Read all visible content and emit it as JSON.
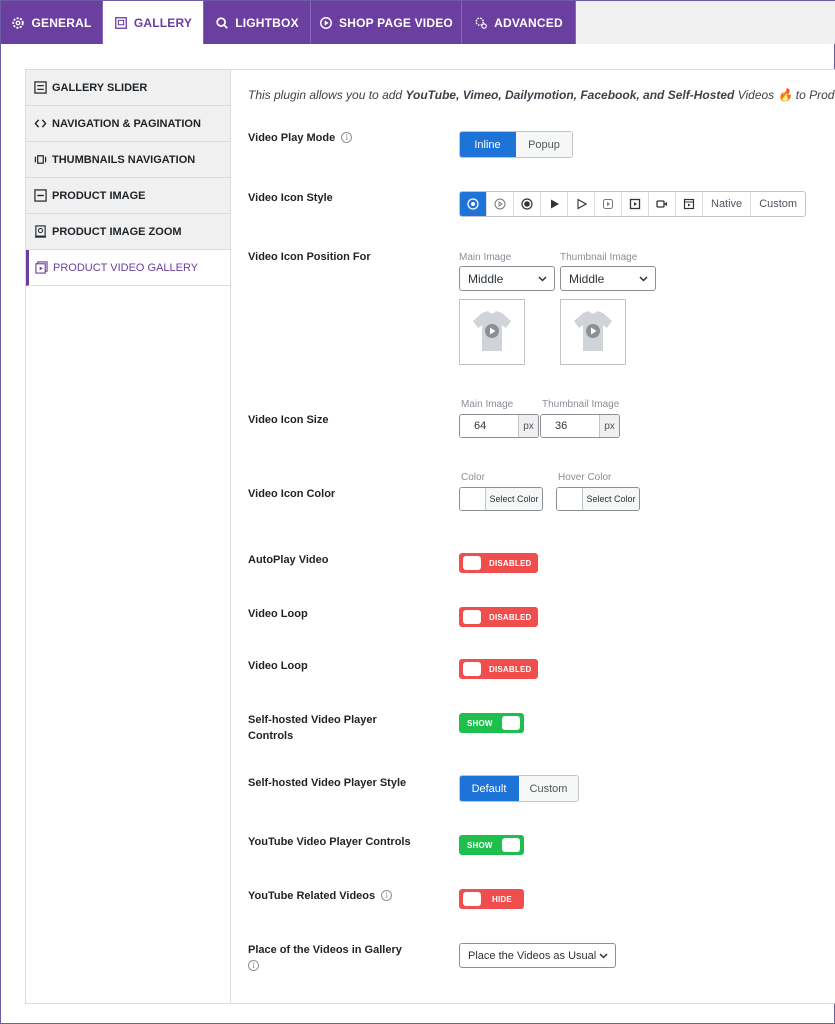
{
  "tabs": [
    {
      "label": "GENERAL",
      "icon": "gear-icon"
    },
    {
      "label": "GALLERY",
      "icon": "gallery-icon"
    },
    {
      "label": "LIGHTBOX",
      "icon": "search-icon"
    },
    {
      "label": "SHOP PAGE VIDEO",
      "icon": "play-circle-icon"
    },
    {
      "label": "ADVANCED",
      "icon": "gear-advanced-icon"
    }
  ],
  "sidebar": {
    "items": [
      {
        "label": "GALLERY SLIDER"
      },
      {
        "label": "NAVIGATION & PAGINATION"
      },
      {
        "label": "THUMBNAILS NAVIGATION"
      },
      {
        "label": "PRODUCT IMAGE"
      },
      {
        "label": "PRODUCT IMAGE ZOOM"
      },
      {
        "label": "PRODUCT VIDEO GALLERY"
      }
    ]
  },
  "intro": {
    "pre": "This plugin allows you to add ",
    "bold": "YouTube, Vimeo, Dailymotion, Facebook, and Self-Hosted",
    "post": " Videos 🔥 to Product"
  },
  "settings": {
    "play_mode": {
      "label": "Video Play Mode",
      "options": [
        "Inline",
        "Popup"
      ],
      "selected": "Inline"
    },
    "icon_style": {
      "label": "Video Icon Style",
      "native": "Native",
      "custom": "Custom"
    },
    "icon_position": {
      "label": "Video Icon Position For",
      "main_label": "Main Image",
      "main_value": "Middle",
      "thumb_label": "Thumbnail Image",
      "thumb_value": "Middle"
    },
    "icon_size": {
      "label": "Video Icon Size",
      "main_label": "Main Image",
      "main_value": "64",
      "main_unit": "px",
      "thumb_label": "Thumbnail Image",
      "thumb_value": "36",
      "thumb_unit": "px"
    },
    "icon_color": {
      "label": "Video Icon Color",
      "color_label": "Color",
      "color_button": "Select Color",
      "hover_label": "Hover Color",
      "hover_button": "Select Color"
    },
    "autoplay": {
      "label": "AutoPlay Video",
      "state": "DISABLED"
    },
    "loop1": {
      "label": "Video Loop",
      "state": "DISABLED"
    },
    "loop2": {
      "label": "Video Loop",
      "state": "DISABLED"
    },
    "sh_controls": {
      "label_line1": "Self-hosted Video Player",
      "label_line2": "Controls",
      "state": "SHOW"
    },
    "sh_style": {
      "label": "Self-hosted Video Player Style",
      "options": [
        "Default",
        "Custom"
      ],
      "selected": "Default"
    },
    "yt_controls": {
      "label": "YouTube Video Player Controls",
      "state": "SHOW"
    },
    "yt_related": {
      "label": "YouTube Related Videos",
      "state": "HIDE"
    },
    "place": {
      "label": "Place of the Videos in Gallery",
      "value": "Place the Videos as Usual"
    }
  },
  "colors": {
    "accent": "#6b3fa0",
    "primary": "#1e73d6",
    "on": "#1fbf4e",
    "off": "#f04d4d"
  }
}
